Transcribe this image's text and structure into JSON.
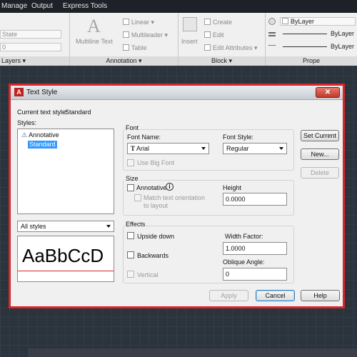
{
  "menubar": {
    "tabs": [
      "Manage",
      "Output",
      "Express Tools"
    ]
  },
  "ribbon": {
    "layers": {
      "combo1": "State",
      "combo2": "0",
      "title": "Layers"
    },
    "annotation": {
      "multiline_text": "Multiline Text",
      "linear": "Linear",
      "multileader": "Multileader",
      "table": "Table",
      "title": "Annotation"
    },
    "block": {
      "insert": "Insert",
      "create": "Create",
      "edit": "Edit",
      "edit_attributes": "Edit Attributes",
      "title": "Block"
    },
    "properties": {
      "bylayer1": "ByLayer",
      "bylayer2": "ByLayer",
      "bylayer3": "ByLayer",
      "title": "Prope"
    }
  },
  "dialog": {
    "title": "Text Style",
    "close_label": "✕",
    "current_style_label": "Current text style:",
    "current_style_value": "Standard",
    "styles_label": "Styles:",
    "styles": [
      {
        "label": "Annotative",
        "selected": false,
        "icon": "annotative-icon"
      },
      {
        "label": "Standard",
        "selected": true
      }
    ],
    "filter_value": "All styles",
    "preview_text": "AaBbCcD",
    "font": {
      "group_title": "Font",
      "font_name_label": "Font Name:",
      "font_name_value": "Arial",
      "font_style_label": "Font Style:",
      "font_style_value": "Regular",
      "use_big_font": "Use Big Font"
    },
    "size": {
      "group_title": "Size",
      "annotative": "Annotative",
      "match_orientation_line1": "Match text orientation",
      "match_orientation_line2": "to layout",
      "height_label": "Height",
      "height_value": "0.0000"
    },
    "effects": {
      "group_title": "Effects",
      "upside_down": "Upside down",
      "backwards": "Backwards",
      "vertical": "Vertical",
      "width_factor_label": "Width Factor:",
      "width_factor_value": "1.0000",
      "oblique_label": "Oblique Angle:",
      "oblique_value": "0"
    },
    "buttons": {
      "set_current": "Set Current",
      "new": "New...",
      "delete": "Delete",
      "apply": "Apply",
      "cancel": "Cancel",
      "help": "Help"
    }
  }
}
